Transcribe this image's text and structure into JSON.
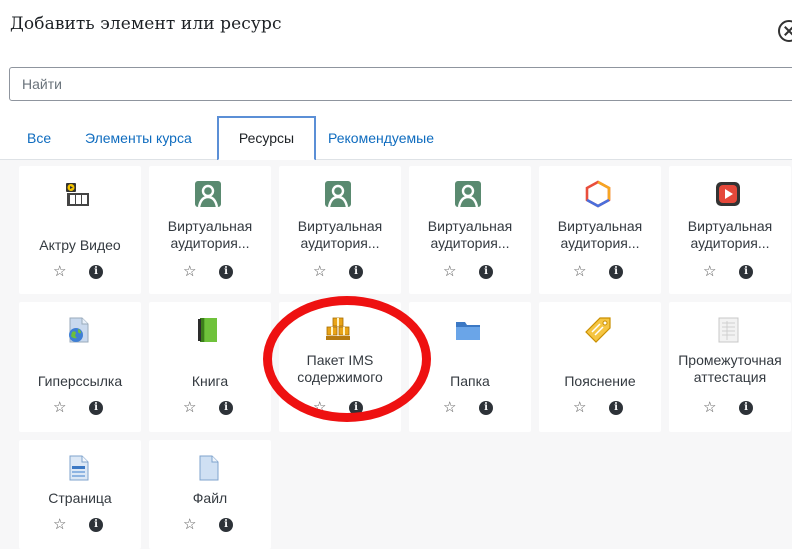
{
  "dialog": {
    "title": "Добавить элемент или ресурс",
    "close_icon": "close-circle-icon"
  },
  "search": {
    "placeholder": "Найти",
    "value": ""
  },
  "tabs": [
    {
      "label": "Все",
      "active": false
    },
    {
      "label": "Элементы курса",
      "active": false
    },
    {
      "label": "Ресурсы",
      "active": true
    },
    {
      "label": "Рекомендуемые",
      "active": false
    }
  ],
  "items": [
    {
      "name": "Актру Видео",
      "icon": "video-camera-icon"
    },
    {
      "name": "Виртуальная аудитория...",
      "icon": "virtual-classroom-icon"
    },
    {
      "name": "Виртуальная аудитория...",
      "icon": "virtual-classroom-icon"
    },
    {
      "name": "Виртуальная аудитория...",
      "icon": "virtual-classroom-icon"
    },
    {
      "name": "Виртуальная аудитория...",
      "icon": "hexagon-icon"
    },
    {
      "name": "Виртуальная аудитория...",
      "icon": "play-button-icon"
    },
    {
      "name": "Гиперссылка",
      "icon": "globe-page-icon"
    },
    {
      "name": "Книга",
      "icon": "book-icon"
    },
    {
      "name": "Пакет IMS содержимого",
      "icon": "package-boxes-icon"
    },
    {
      "name": "Папка",
      "icon": "folder-icon"
    },
    {
      "name": "Пояснение",
      "icon": "label-tag-icon"
    },
    {
      "name": "Промежуточная аттестация",
      "icon": "grade-sheet-icon"
    },
    {
      "name": "Страница",
      "icon": "page-icon"
    },
    {
      "name": "Файл",
      "icon": "file-icon"
    }
  ],
  "item_actions": {
    "star_glyph": "☆",
    "info_glyph": "i",
    "star_icon": "star-outline-icon",
    "info_icon": "info-circle-icon"
  },
  "colors": {
    "link": "#0f6cbf",
    "active_tab_border": "#5b8fd6",
    "annotation_ring": "#ee1111",
    "grid_background": "#f7f7f8"
  }
}
